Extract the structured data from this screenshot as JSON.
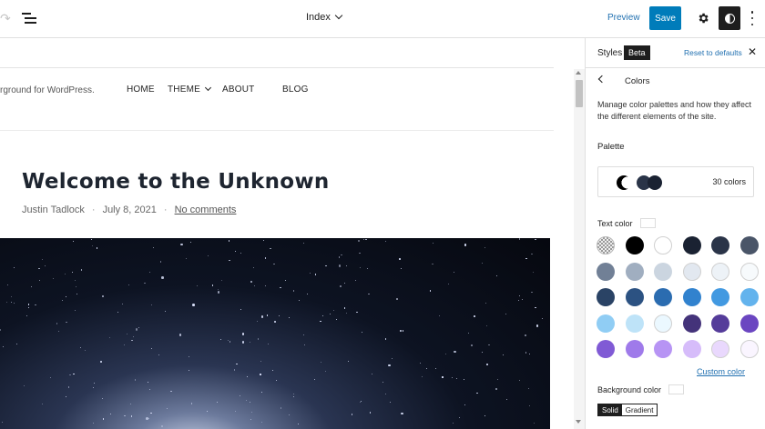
{
  "topbar": {
    "doc_title": "Index",
    "preview_label": "Preview",
    "save_label": "Save"
  },
  "site": {
    "tagline": "rground for WordPress.",
    "nav": [
      "HOME",
      "THEME",
      "ABOUT",
      "BLOG"
    ]
  },
  "post": {
    "title": "Welcome to the Unknown",
    "author": "Justin Tadlock",
    "date": "July 8, 2021",
    "comments": "No comments",
    "separator": "·"
  },
  "panel": {
    "title": "Styles",
    "badge": "Beta",
    "reset": "Reset to defaults",
    "section": "Colors",
    "description": "Manage color palettes and how they affect the different elements of the site.",
    "palette_label": "Palette",
    "palette_count": "30 colors",
    "text_color_label": "Text color",
    "custom_color_label": "Custom color",
    "background_color_label": "Background color",
    "seg_solid": "Solid",
    "seg_gradient": "Gradient",
    "swatches": [
      "#bdbdbd",
      "#000000",
      "#ffffff",
      "#1a2232",
      "#2a3448",
      "#4a5568",
      "#718096",
      "#a0aec0",
      "#cbd5e0",
      "#e2e8f0",
      "#edf2f7",
      "#f7fafc",
      "#2a4365",
      "#2c5282",
      "#2b6cb0",
      "#3182ce",
      "#4299e1",
      "#63b3ed",
      "#90cdf4",
      "#bee3f8",
      "#ebf8ff",
      "#44337a",
      "#553c9a",
      "#6b46c1",
      "#805ad5",
      "#9f7aea",
      "#b794f4",
      "#d6bcfa",
      "#e9d8fd",
      "#faf5ff"
    ],
    "palette_preview": [
      "#000000",
      "#2a3448",
      "#1a2232"
    ]
  }
}
